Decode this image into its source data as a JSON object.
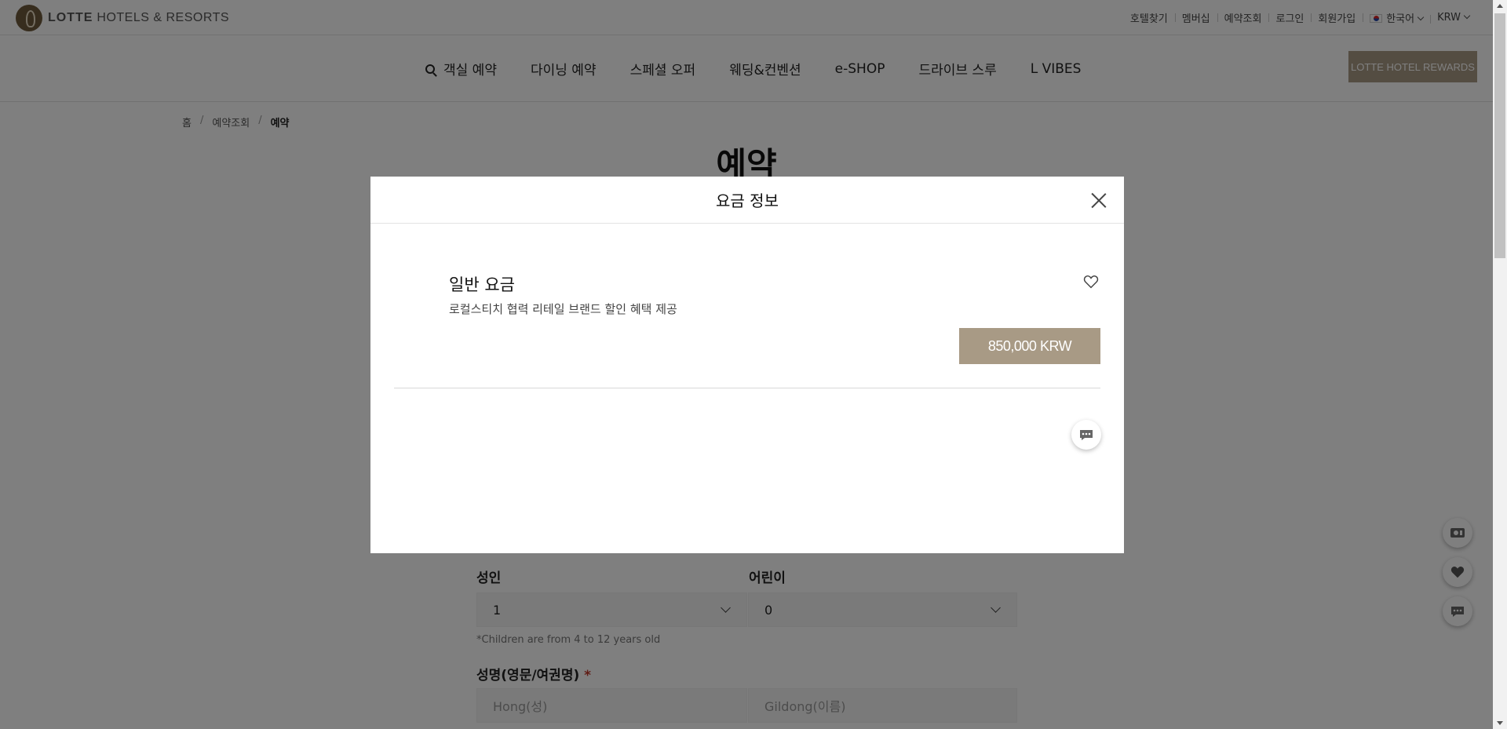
{
  "header": {
    "brand_name": "LOTTE",
    "brand_suffix": "HOTELS & RESORTS",
    "utility_links": [
      "호텔찾기",
      "멤버십",
      "예약조회",
      "로그인",
      "회원가입"
    ],
    "language": "한국어",
    "currency": "KRW"
  },
  "nav": {
    "items": [
      "객실 예약",
      "다이닝 예약",
      "스페셜 오퍼",
      "웨딩&컨벤션",
      "e-SHOP",
      "드라이브 스루",
      "L VIBES"
    ],
    "rewards_label": "LOTTE HOTEL REWARDS"
  },
  "breadcrumb": [
    "홈",
    "예약조회",
    "예약"
  ],
  "page": {
    "title": "예약"
  },
  "form": {
    "adult_label": "성인",
    "adult_value": "1",
    "child_label": "어린이",
    "child_value": "0",
    "children_note": "*Children are from 4 to 12 years old",
    "name_label": "성명(영문/여권명)",
    "required_mark": "*",
    "last_name_placeholder": "Hong(성)",
    "first_name_placeholder": "Gildong(이름)"
  },
  "modal": {
    "title": "요금 정보",
    "rate_name": "일반 요금",
    "rate_description": "로컬스티치 협력 리테일 브랜드 할인 혜택 제공",
    "price": "850,000 KRW"
  },
  "icons": {
    "close": "close-icon",
    "wishlist": "heart-icon",
    "chat": "chat-icon",
    "search": "search-icon",
    "coupon": "ticket-icon"
  },
  "colors": {
    "accent": "#a89a85",
    "logo": "#6e5a3c",
    "overlay": "rgba(0,0,0,0.5)",
    "required": "#c0392b"
  }
}
